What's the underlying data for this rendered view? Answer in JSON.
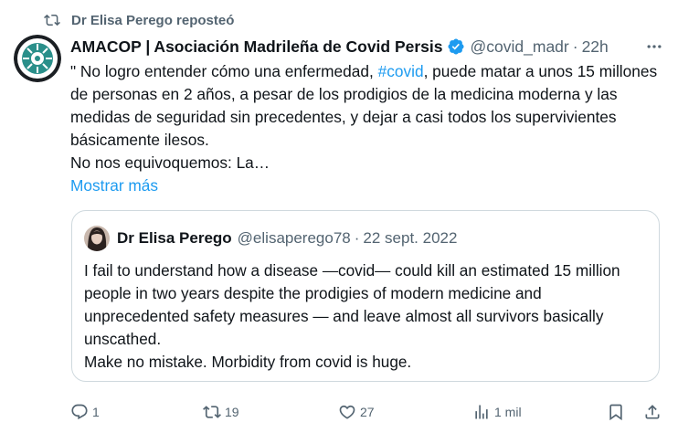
{
  "repost": {
    "label": "Dr Elisa Perego reposteó"
  },
  "tweet": {
    "author_name": "AMACOP | Asociación Madrileña de Covid Persis",
    "handle": "@covid_madr",
    "separator": "·",
    "time": "22h",
    "text_before_hashtag": "\" No logro entender cómo una enfermedad, ",
    "hashtag": "#covid",
    "text_after_hashtag": ", puede matar a unos 15 millones de personas en 2 años, a pesar de los prodigios de la medicina moderna y las medidas de seguridad sin precedentes, y dejar a casi todos los supervivientes básicamente ilesos.",
    "text_line2": "No nos equivoquemos: La…",
    "show_more": "Mostrar más"
  },
  "quote": {
    "author_name": "Dr Elisa Perego",
    "handle": "@elisaperego78",
    "separator": "·",
    "date": "22 sept. 2022",
    "text": "I fail to understand how a disease —covid— could kill an estimated 15 million people in two years despite the prodigies of modern medicine and unprecedented safety measures — and leave almost all survivors basically unscathed.",
    "text_line2": "Make no mistake. Morbidity from covid is huge."
  },
  "actions": {
    "replies": "1",
    "reposts": "19",
    "likes": "27",
    "views": "1 mil"
  },
  "icons": {
    "repost": "repost-icon",
    "verified": "verified-badge-icon",
    "more": "more-options-icon",
    "reply": "reply-icon",
    "retweet": "retweet-icon",
    "like": "heart-icon",
    "views": "views-chart-icon",
    "bookmark": "bookmark-icon",
    "share": "share-icon"
  },
  "colors": {
    "link": "#1d9bf0",
    "secondary_text": "#536471",
    "border": "#cfd9de",
    "repost_active": "#536471",
    "avatar_org": "#2a8f8a"
  }
}
